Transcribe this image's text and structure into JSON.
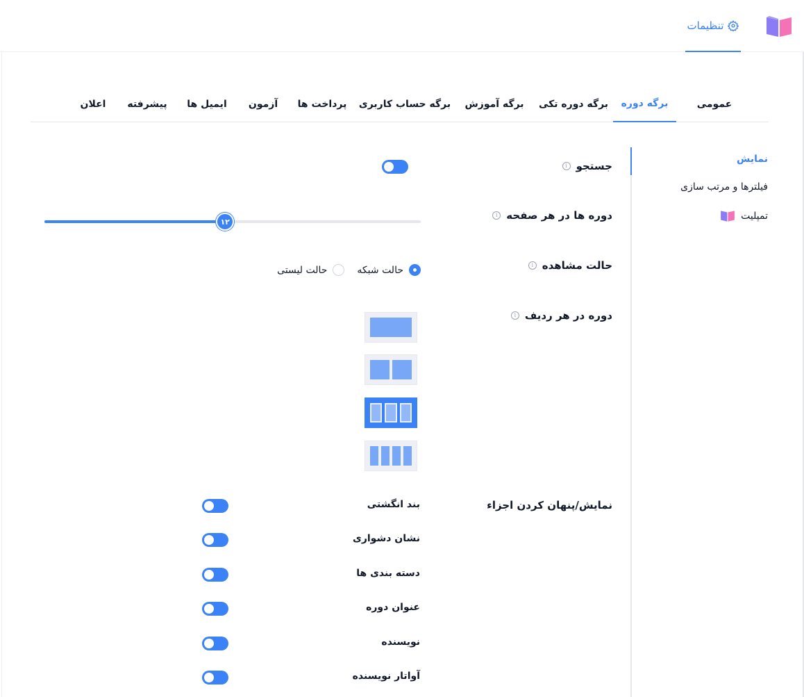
{
  "topbar": {
    "settings_tab_label": "تنظیمات"
  },
  "tabs": [
    {
      "label": "عمومی",
      "active": false
    },
    {
      "label": "برگه دوره",
      "active": true
    },
    {
      "label": "برگه دوره تکی",
      "active": false
    },
    {
      "label": "برگه آموزش",
      "active": false
    },
    {
      "label": "برگه حساب کاربری",
      "active": false
    },
    {
      "label": "پرداخت ها",
      "active": false
    },
    {
      "label": "آزمون",
      "active": false
    },
    {
      "label": "ایمیل ها",
      "active": false
    },
    {
      "label": "پیشرفته",
      "active": false
    },
    {
      "label": "اعلان",
      "active": false
    }
  ],
  "sidebar": {
    "items": [
      {
        "label": "نمایش",
        "active": true
      },
      {
        "label": "فیلترها و مرتب سازی",
        "active": false
      },
      {
        "label": "تمپلیت",
        "active": false
      }
    ]
  },
  "settings": {
    "search": {
      "label": "جستجو",
      "enabled": true
    },
    "courses_per_page": {
      "label": "دوره ها در هر صفحه",
      "value": "۱۲",
      "fraction": 0.48
    },
    "view_mode": {
      "label": "حالت مشاهده",
      "options": [
        {
          "label": "حالت شبکه",
          "checked": true
        },
        {
          "label": "حالت لیستی",
          "checked": false
        }
      ]
    },
    "courses_per_row": {
      "label": "دوره در هر ردیف",
      "options": [
        1,
        2,
        3,
        4
      ],
      "selected": 3
    },
    "show_hide": {
      "label": "نمایش/پنهان کردن اجزاء",
      "items": [
        {
          "label": "بند انگشتی",
          "enabled": true
        },
        {
          "label": "نشان دشواری",
          "enabled": true
        },
        {
          "label": "دسته بندی ها",
          "enabled": true
        },
        {
          "label": "عنوان دوره",
          "enabled": true
        },
        {
          "label": "نویسنده",
          "enabled": true
        },
        {
          "label": "آواتار نویسنده",
          "enabled": true
        }
      ]
    }
  },
  "colors": {
    "accent": "#3b82f6",
    "logo_left": "#8b7cf6",
    "logo_right": "#f472b6"
  }
}
